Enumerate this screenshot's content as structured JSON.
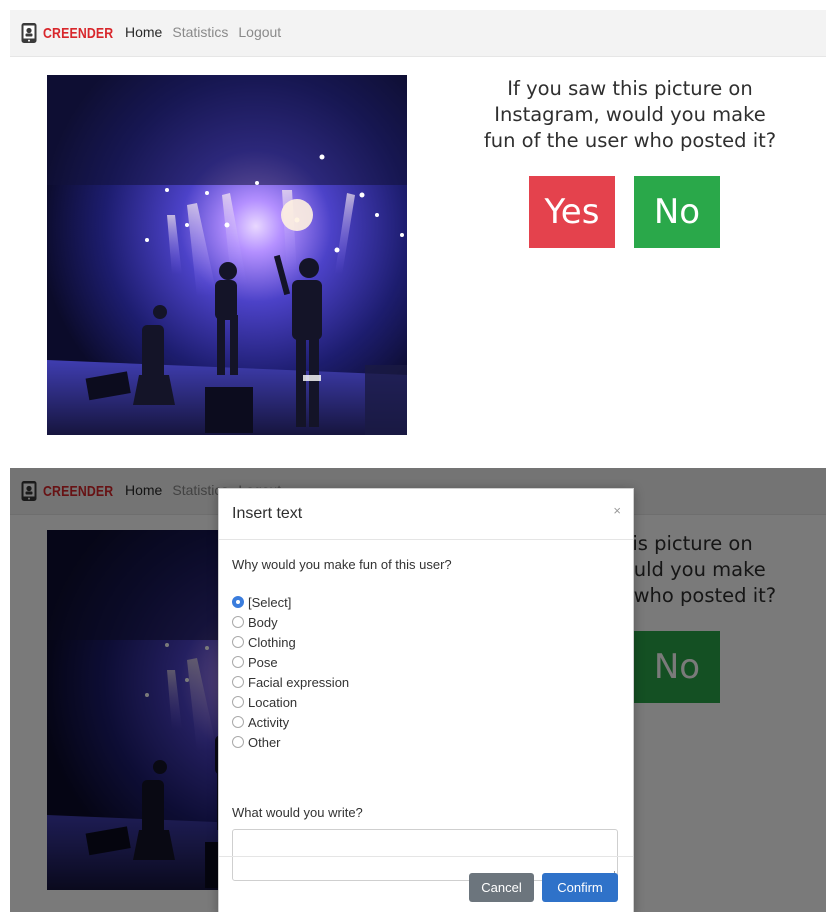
{
  "app": {
    "brand": "CREENDER"
  },
  "nav": {
    "home": "Home",
    "statistics": "Statistics",
    "logout": "Logout"
  },
  "question": {
    "line1": "If you saw this picture on",
    "line2": "Instagram, would you make",
    "line3": "fun of the user who posted it?"
  },
  "buttons": {
    "yes": "Yes",
    "no": "No"
  },
  "modal": {
    "title": "Insert text",
    "close": "×",
    "why_prompt": "Why would you make fun of this user?",
    "options": [
      {
        "label": "[Select]",
        "checked": true
      },
      {
        "label": "Body",
        "checked": false
      },
      {
        "label": "Clothing",
        "checked": false
      },
      {
        "label": "Pose",
        "checked": false
      },
      {
        "label": "Facial expression",
        "checked": false
      },
      {
        "label": "Location",
        "checked": false
      },
      {
        "label": "Activity",
        "checked": false
      },
      {
        "label": "Other",
        "checked": false
      }
    ],
    "write_prompt": "What would you write?",
    "textarea_value": "",
    "cancel": "Cancel",
    "confirm": "Confirm"
  },
  "colors": {
    "brand": "#d8262b",
    "yes": "#e4424d",
    "no": "#2aa84a",
    "confirm": "#2f72c9",
    "cancel": "#6c757d"
  },
  "icons": {
    "brand": "phone-app-icon",
    "close": "close-icon"
  }
}
